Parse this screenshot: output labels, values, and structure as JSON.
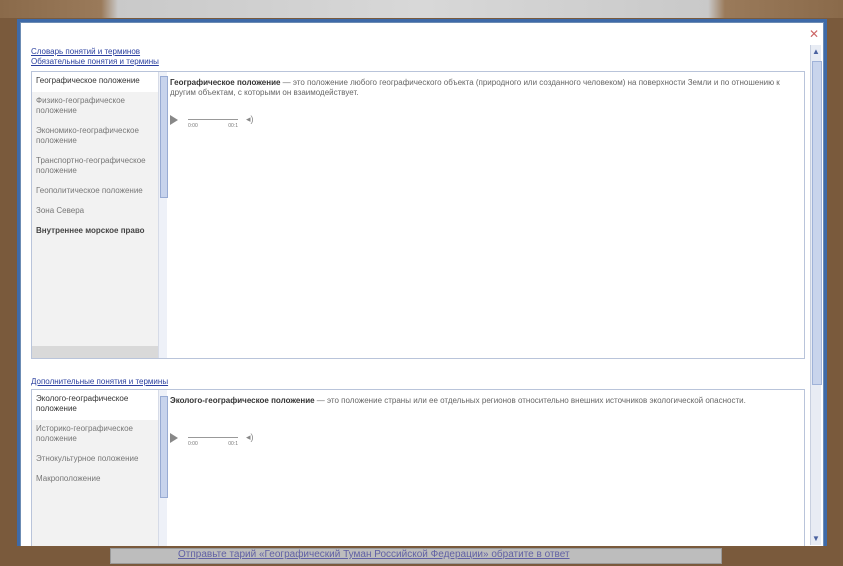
{
  "dialog": {
    "close_glyph": "✕",
    "title": "Словарь понятий и терминов"
  },
  "section1": {
    "title": "Обязательные понятия и термины",
    "items": [
      {
        "label": "Географическое положение"
      },
      {
        "label": "Физико-географическое положение"
      },
      {
        "label": "Экономико-географическое положение"
      },
      {
        "label": "Транспортно-географическое положение"
      },
      {
        "label": "Геополитическое положение"
      },
      {
        "label": "Зона Севера"
      },
      {
        "label": "Внутреннее морское право"
      }
    ],
    "term": "Географическое положение",
    "definition": " — это положение любого географического объекта (природного или созданного человеком) на поверхности Земли и по отношению к другим объектам, с которыми он взаимодействует."
  },
  "section2": {
    "title": "Дополнительные понятия и термины",
    "items": [
      {
        "label": "Эколого-географическое положение"
      },
      {
        "label": "Историко-географическое положение"
      },
      {
        "label": "Этнокультурное положение"
      },
      {
        "label": "Макроположение"
      }
    ],
    "term": "Эколого-географическое положение",
    "definition": " — это положение страны или ее отдельных регионов относительно внешних источников экологической опасности."
  },
  "player": {
    "time_start": "0:00",
    "time_end": "00:1",
    "volume_glyph": "◂)"
  },
  "taskbar": {
    "link": "Отправьте тарий «Географический Туман Российской Федерации» обратите в ответ"
  },
  "colors": {
    "window_border": "#3e6aa8",
    "link_blue": "#2a3f9f",
    "frame_brown": "#7a5a3c"
  }
}
